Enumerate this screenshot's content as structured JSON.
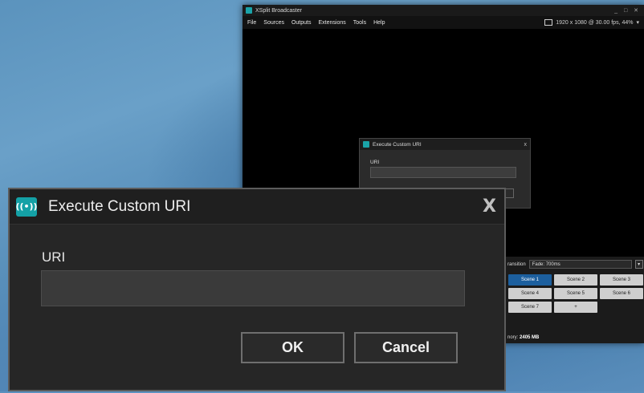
{
  "app": {
    "title": "XSplit Broadcaster",
    "window_controls": "_ □ ✕",
    "menu": [
      "File",
      "Sources",
      "Outputs",
      "Extensions",
      "Tools",
      "Help"
    ],
    "resolution": "1920 x 1080 @ 30.00 fps, 44%"
  },
  "transition": {
    "label": "ransition",
    "value": "Fade: 700ms"
  },
  "scenes": [
    "Scene 1",
    "Scene 2",
    "Scene 3",
    "Scene 4",
    "Scene 5",
    "Scene 6",
    "Scene 7",
    "+"
  ],
  "active_scene_index": 0,
  "memory": {
    "label": "nory:",
    "value": "2405 MB"
  },
  "dialog": {
    "title": "Execute Custom URI",
    "close_glyph": "X",
    "logo_glyph": "((•))",
    "uri_label": "URI",
    "uri_value": "",
    "ok_label": "OK",
    "cancel_label": "Cancel"
  },
  "small_dialog": {
    "title": "Execute Custom URI",
    "close_glyph": "x",
    "uri_label": "URI"
  },
  "colors": {
    "accent": "#14a1a6",
    "active_scene": "#1c5f9e",
    "desktop": "#5b93bd"
  }
}
